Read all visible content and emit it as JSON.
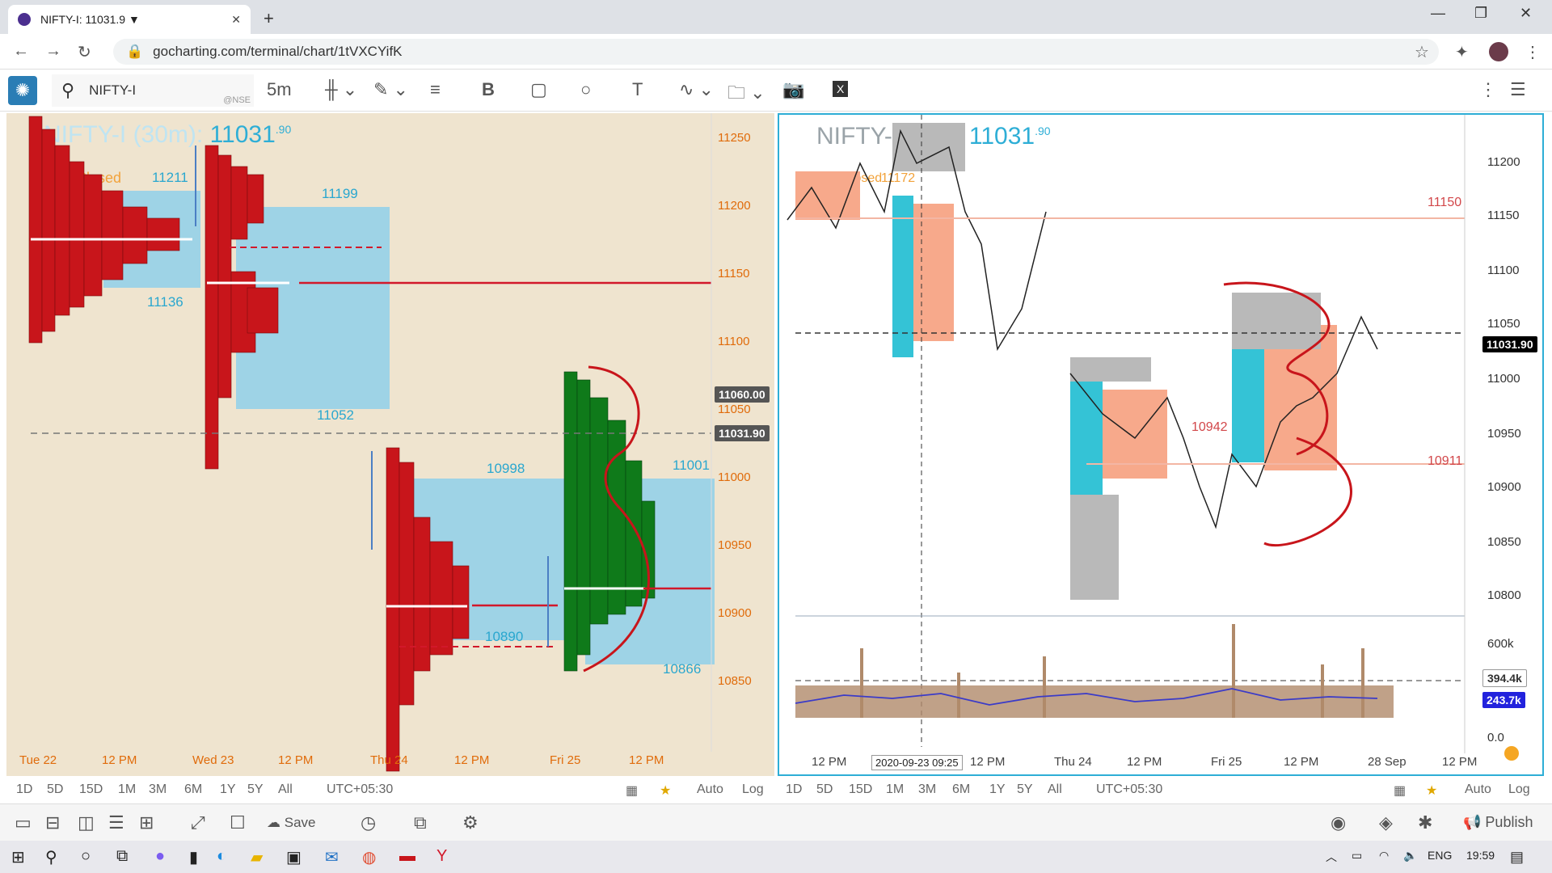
{
  "browser": {
    "tab_title": "NIFTY-I: 11031.9 ▼",
    "url": "gocharting.com/terminal/chart/1tVXCYifK"
  },
  "toolbar": {
    "symbol": "NIFTY-I",
    "exchange": "@NSE",
    "interval": "5m"
  },
  "left_chart": {
    "title_prefix": "NIFTY-I (30m):",
    "price_main": "11031",
    "price_dec": ".90",
    "status": "NSE Closed",
    "price_axis": [
      "11250",
      "11200",
      "11150",
      "11100",
      "11050",
      "11000",
      "10950",
      "10900",
      "10850"
    ],
    "tag_price1": "11060.00",
    "tag_price2": "11031.90",
    "time_axis": [
      "Tue 22",
      "12 PM",
      "Wed 23",
      "12 PM",
      "Thu 24",
      "12 PM",
      "Fri 25",
      "12 PM"
    ],
    "value_labels": [
      "11211",
      "11199",
      "11136",
      "11052",
      "10998",
      "11001",
      "10890",
      "10866"
    ]
  },
  "right_chart": {
    "title_prefix": "NIFTY-I (5m):",
    "price_main": "11031",
    "price_dec": ".90",
    "status": "NSE Closed",
    "extra_label": "11172",
    "price_axis": [
      "11200",
      "11150",
      "11100",
      "11050",
      "11000",
      "10950",
      "10900",
      "10850",
      "10800"
    ],
    "tag_price": "11031.90",
    "level_labels": [
      "11150",
      "10942",
      "10911"
    ],
    "volume_axis": [
      "600k",
      "0.0"
    ],
    "vol_tag1": "394.4k",
    "vol_tag2": "243.7k",
    "time_axis": [
      "12 PM",
      "12 PM",
      "Thu 24",
      "12 PM",
      "Fri 25",
      "12 PM",
      "28 Sep",
      "12 PM"
    ],
    "crosshair_time": "2020-09-23 09:25"
  },
  "range_bar": {
    "ranges": [
      "1D",
      "5D",
      "15D",
      "1M",
      "3M",
      "6M",
      "1Y",
      "5Y",
      "All"
    ],
    "timezone": "UTC+05:30",
    "auto": "Auto",
    "log": "Log"
  },
  "statusbar": {
    "save": "Save",
    "publish": "Publish"
  },
  "taskbar": {
    "lang": "ENG",
    "time": "19:59"
  }
}
